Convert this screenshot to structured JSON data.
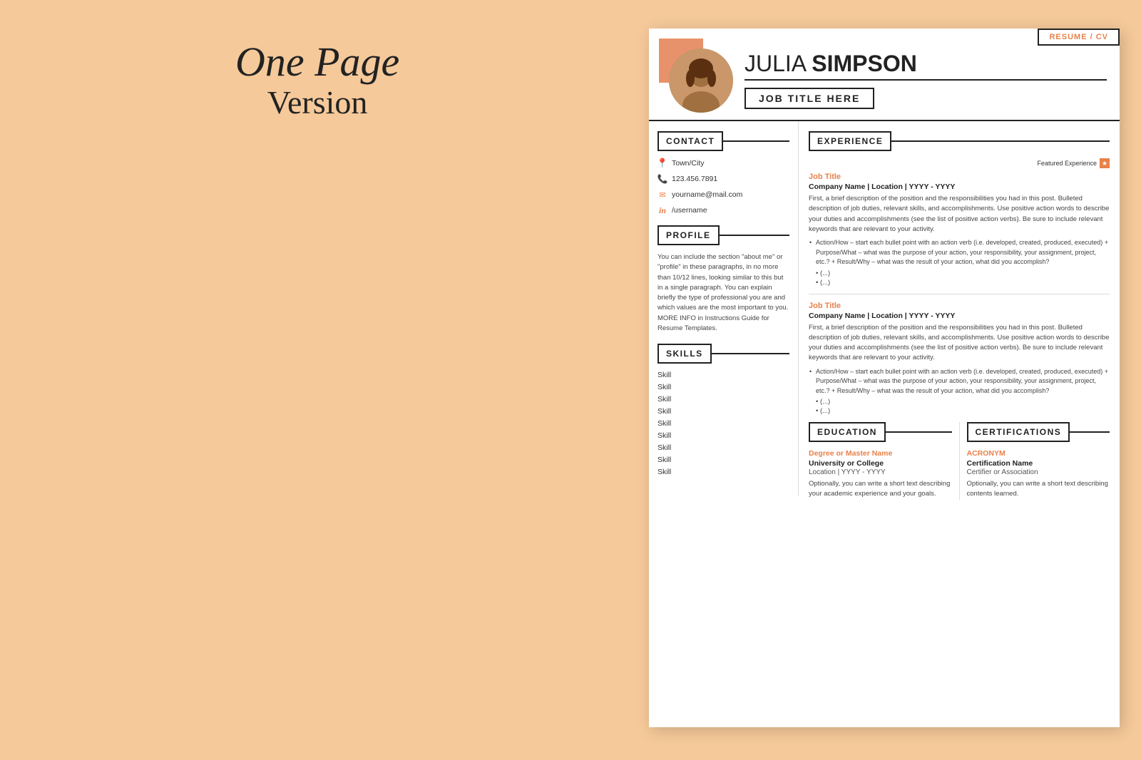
{
  "page": {
    "title_line1": "One Page",
    "title_line2": "Version"
  },
  "resume_badge": "RESUME / CV",
  "header": {
    "name_first": "JULIA",
    "name_last": "SIMPSON",
    "job_title": "JOB TITLE HERE"
  },
  "contact": {
    "section_label": "CONTACT",
    "location": "Town/City",
    "phone": "123.456.7891",
    "email": "yourname@mail.com",
    "linkedin": "/username"
  },
  "profile": {
    "section_label": "PROFILE",
    "text": "You can include the section \"about me\" or \"profile\" in these paragraphs, in no more than 10/12 lines, looking similar to this but in a single paragraph. You can explain briefly the type of professional you are and which values are the most important to you. MORE INFO in Instructions Guide for Resume Templates."
  },
  "skills": {
    "section_label": "SKILLS",
    "items": [
      "Skill",
      "Skill",
      "Skill",
      "Skill",
      "Skill",
      "Skill",
      "Skill",
      "Skill",
      "Skill"
    ]
  },
  "experience": {
    "section_label": "EXPERIENCE",
    "featured_label": "Featured Experience",
    "jobs": [
      {
        "title": "Job Title",
        "company": "Company Name | Location | YYYY - YYYY",
        "description": "First, a brief description of the position and the responsibilities you had in this post. Bulleted description of job duties, relevant skills, and accomplishments. Use positive action words to describe your duties and accomplishments (see the list of positive action verbs). Be sure to include relevant keywords that are relevant to your activity.",
        "bullet1": "Action/How – start each bullet point with an action verb (i.e. developed, created, produced, executed) + Purpose/What – what was the purpose of your action, your responsibility, your assignment, project, etc.? + Result/Why – what was the result of your action, what did you accomplish?",
        "extra_bullets": [
          "(...)",
          "(...)"
        ]
      },
      {
        "title": "Job Title",
        "company": "Company Name | Location | YYYY - YYYY",
        "description": "First, a brief description of the position and the responsibilities you had in this post. Bulleted description of job duties, relevant skills, and accomplishments. Use positive action words to describe your duties and accomplishments (see the list of positive action verbs). Be sure to include relevant keywords that are relevant to your activity.",
        "bullet1": "Action/How – start each bullet point with an action verb (i.e. developed, created, produced, executed) + Purpose/What – what was the purpose of your action, your responsibility, your assignment, project, etc.? + Result/Why – what was the result of your action, what did you accomplish?",
        "extra_bullets": [
          "(...)",
          "(...)"
        ]
      }
    ]
  },
  "education": {
    "section_label": "EDUCATION",
    "degree": "Degree or Master Name",
    "school": "University or College",
    "location": "Location | YYYY - YYYY",
    "description": "Optionally, you can write a short text describing your academic experience and your goals."
  },
  "certifications": {
    "section_label": "CERTIFICATIONS",
    "acronym": "ACRONYM",
    "cert_name": "Certification Name",
    "certifier": "Certifier or Association",
    "description": "Optionally, you can write a short text describing contents learned."
  }
}
